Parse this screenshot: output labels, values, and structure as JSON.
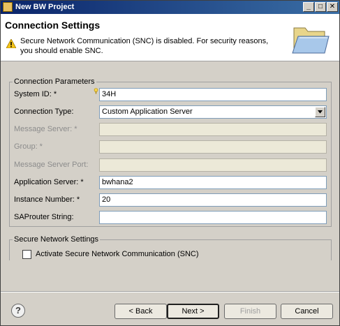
{
  "window": {
    "title": "New BW Project"
  },
  "header": {
    "title": "Connection Settings",
    "message": "Secure Network Communication (SNC) is disabled. For security reasons, you should enable SNC."
  },
  "connection_parameters": {
    "legend": "Connection Parameters",
    "system_id": {
      "label": "System ID: *",
      "value": "34H"
    },
    "connection_type": {
      "label": "Connection Type:",
      "value": "Custom Application Server"
    },
    "message_server": {
      "label": "Message Server: *",
      "value": ""
    },
    "group": {
      "label": "Group: *",
      "value": ""
    },
    "message_server_port": {
      "label": "Message Server Port:",
      "value": ""
    },
    "application_server": {
      "label": "Application Server: *",
      "value": "bwhana2"
    },
    "instance_number": {
      "label": "Instance Number: *",
      "value": "20"
    },
    "saprouter": {
      "label": "SAProuter String:",
      "value": ""
    }
  },
  "secure_network": {
    "legend": "Secure Network Settings",
    "activate_snc_label": "Activate Secure Network Communication (SNC)",
    "activate_snc_checked": false
  },
  "buttons": {
    "help": "?",
    "back": "< Back",
    "next": "Next >",
    "finish": "Finish",
    "cancel": "Cancel"
  }
}
